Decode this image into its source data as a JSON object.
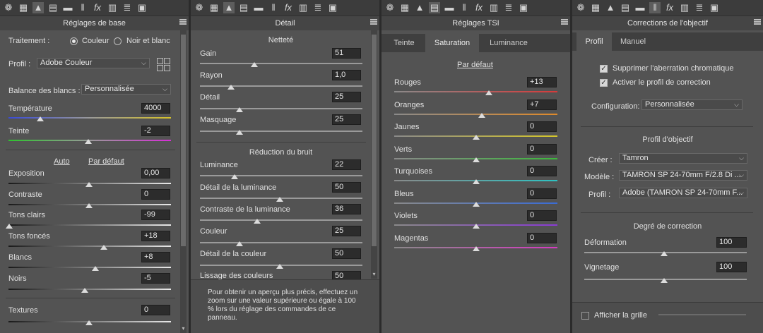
{
  "toolbar_icons": [
    "aperture-icon",
    "grid-icon",
    "triangle-icon",
    "split-icon",
    "split-alt-icon",
    "lens-icon",
    "fx-icon",
    "film-icon",
    "sliders-icon",
    "presets-icon"
  ],
  "basic": {
    "title": "Réglages de base",
    "treatment_label": "Traitement :",
    "color_label": "Couleur",
    "bw_label": "Noir et blanc",
    "profile_label": "Profil :",
    "profile_value": "Adobe Couleur",
    "wb_label": "Balance des blancs :",
    "wb_value": "Personnalisée",
    "temp_label": "Température",
    "temp_value": "4000",
    "tint_label": "Teinte",
    "tint_value": "-2",
    "auto_label": "Auto",
    "default_label": "Par défaut",
    "exposure_label": "Exposition",
    "exposure_value": "0,00",
    "contrast_label": "Contraste",
    "contrast_value": "0",
    "highlights_label": "Tons clairs",
    "highlights_value": "-99",
    "shadows_label": "Tons foncés",
    "shadows_value": "+18",
    "whites_label": "Blancs",
    "whites_value": "+8",
    "blacks_label": "Noirs",
    "blacks_value": "-5",
    "texture_label": "Textures",
    "texture_value": "0"
  },
  "detail": {
    "title": "Détail",
    "sharpen_title": "Netteté",
    "amount_label": "Gain",
    "amount_value": "51",
    "radius_label": "Rayon",
    "radius_value": "1,0",
    "detail_label": "Détail",
    "detail_value": "25",
    "masking_label": "Masquage",
    "masking_value": "25",
    "noise_title": "Réduction du bruit",
    "lum_label": "Luminance",
    "lum_value": "22",
    "lumdetail_label": "Détail de la luminance",
    "lumdetail_value": "50",
    "lumcontrast_label": "Contraste de la luminance",
    "lumcontrast_value": "36",
    "color_label": "Couleur",
    "color_value": "25",
    "colordetail_label": "Détail de la couleur",
    "colordetail_value": "50",
    "smooth_label": "Lissage des couleurs",
    "smooth_value": "50",
    "note": "Pour obtenir un aperçu plus précis, effectuez un zoom sur une valeur supérieure ou égale à 100 % lors du réglage des commandes de ce panneau."
  },
  "hsl": {
    "title": "Réglages TSI",
    "tabs": [
      "Teinte",
      "Saturation",
      "Luminance"
    ],
    "default_label": "Par défaut",
    "rows": [
      {
        "label": "Rouges",
        "value": "+13",
        "color": "#d63a3a",
        "fraction": 0.578
      },
      {
        "label": "Oranges",
        "value": "+7",
        "color": "#e08a2a",
        "fraction": 0.538
      },
      {
        "label": "Jaunes",
        "value": "0",
        "color": "#d6c72a",
        "fraction": 0.5
      },
      {
        "label": "Verts",
        "value": "0",
        "color": "#3cb83c",
        "fraction": 0.5
      },
      {
        "label": "Turquoises",
        "value": "0",
        "color": "#2ec2c2",
        "fraction": 0.5
      },
      {
        "label": "Bleus",
        "value": "0",
        "color": "#3a6cd6",
        "fraction": 0.5
      },
      {
        "label": "Violets",
        "value": "0",
        "color": "#8a3ad6",
        "fraction": 0.5
      },
      {
        "label": "Magentas",
        "value": "0",
        "color": "#d63ac2",
        "fraction": 0.5
      }
    ]
  },
  "lens": {
    "title": "Corrections de l'objectif",
    "tab_profile": "Profil",
    "tab_manual": "Manuel",
    "ca_label": "Supprimer l'aberration chromatique",
    "profile_enable_label": "Activer le profil de correction",
    "config_label": "Configuration:",
    "config_value": "Personnalisée",
    "lens_profile_title": "Profil d'objectif",
    "make_label": "Créer :",
    "make_value": "Tamron",
    "model_label": "Modèle :",
    "model_value": "TAMRON SP 24-70mm F/2.8 Di ...",
    "profile_label": "Profil :",
    "profile_value": "Adobe (TAMRON SP 24-70mm F...",
    "amount_title": "Degré de correction",
    "distortion_label": "Déformation",
    "distortion_value": "100",
    "vignetting_label": "Vignetage",
    "vignetting_value": "100",
    "grid_label": "Afficher la grille"
  }
}
